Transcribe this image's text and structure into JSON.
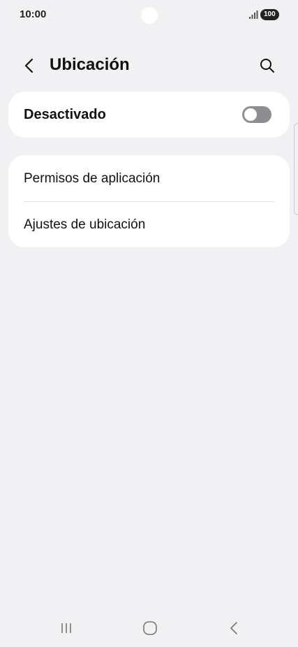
{
  "status_bar": {
    "time": "10:00",
    "battery": "100"
  },
  "header": {
    "title": "Ubicación"
  },
  "location_toggle": {
    "label": "Desactivado",
    "state": "off"
  },
  "settings_list": {
    "items": [
      {
        "label": "Permisos de aplicación"
      },
      {
        "label": "Ajustes de ubicación"
      }
    ]
  },
  "colors": {
    "background": "#f1f1f3",
    "card": "#ffffff",
    "toggle_off": "#8e8e92"
  },
  "icons": {
    "back": "back-arrow-icon",
    "search": "search-icon",
    "nav_recents": "recents-icon",
    "nav_home": "home-icon",
    "nav_back": "nav-back-icon"
  }
}
